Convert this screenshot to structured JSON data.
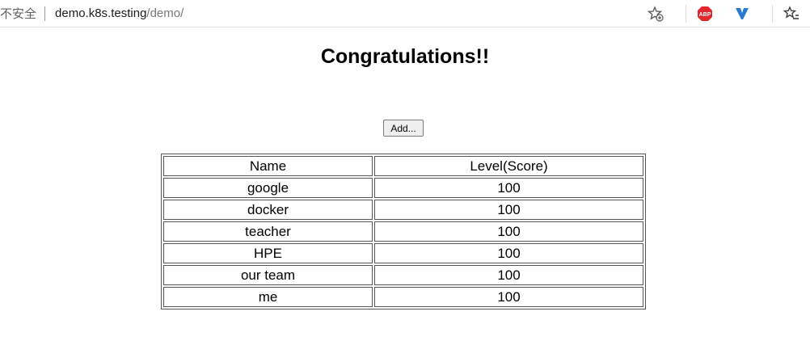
{
  "browser": {
    "security_label": "不安全",
    "url_host": "demo.k8s.testing",
    "url_path": "/demo/",
    "icons": [
      "favorite-star-icon",
      "adblock-plus-icon",
      "extension-icon",
      "favorites-bar-icon"
    ]
  },
  "page": {
    "title": "Congratulations!!",
    "add_button_label": "Add...",
    "table": {
      "headers": [
        "Name",
        "Level(Score)"
      ],
      "rows": [
        [
          "google",
          "100"
        ],
        [
          "docker",
          "100"
        ],
        [
          "teacher",
          "100"
        ],
        [
          "HPE",
          "100"
        ],
        [
          "our team",
          "100"
        ],
        [
          "me",
          "100"
        ]
      ]
    }
  },
  "colors": {
    "abp_red": "#e4262d",
    "extension_blue": "#2a7bd0"
  }
}
